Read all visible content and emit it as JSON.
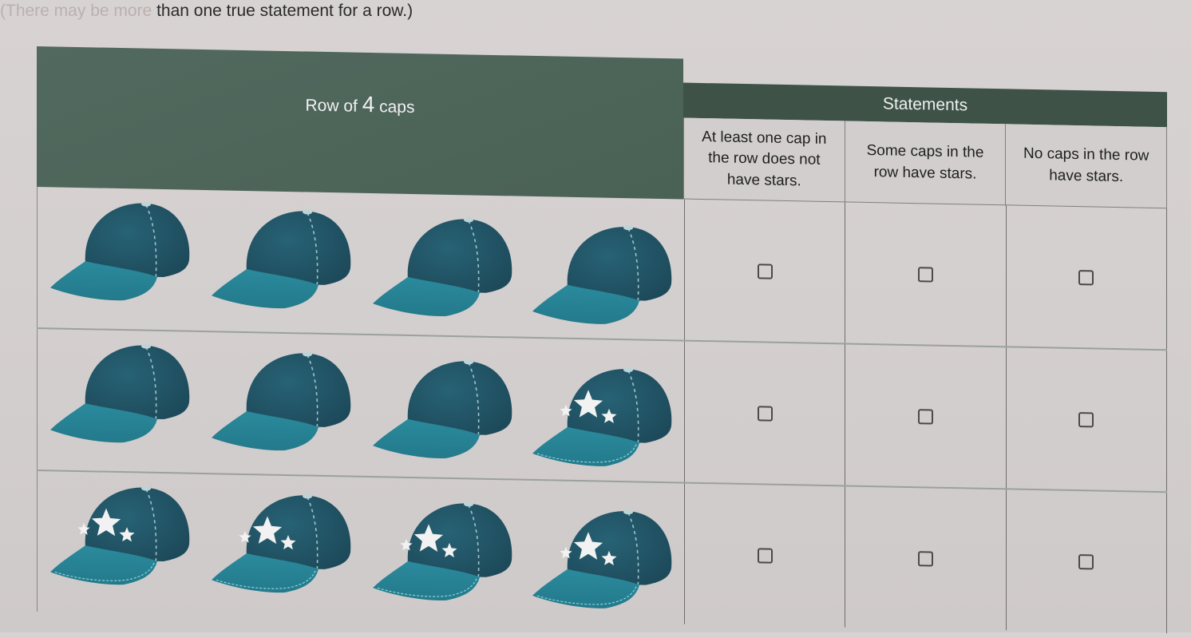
{
  "instruction": {
    "faded_part": "(There may be more ",
    "main_part": "than one true statement for a row.)"
  },
  "table": {
    "left_header": {
      "prefix": "Row of ",
      "number": "4",
      "suffix": " caps"
    },
    "statements_header": "Statements",
    "statements": [
      "At least one cap in the row does not have stars.",
      "Some caps in the row have stars.",
      "No caps in the row have stars."
    ],
    "rows": [
      {
        "caps": [
          {
            "stars": false,
            "icon": "cap-plain-icon"
          },
          {
            "stars": false,
            "icon": "cap-plain-icon"
          },
          {
            "stars": false,
            "icon": "cap-plain-icon"
          },
          {
            "stars": false,
            "icon": "cap-plain-icon"
          }
        ],
        "checked": [
          false,
          false,
          false
        ]
      },
      {
        "caps": [
          {
            "stars": false,
            "icon": "cap-plain-icon"
          },
          {
            "stars": false,
            "icon": "cap-plain-icon"
          },
          {
            "stars": false,
            "icon": "cap-plain-icon"
          },
          {
            "stars": true,
            "icon": "cap-stars-icon"
          }
        ],
        "checked": [
          false,
          false,
          false
        ]
      },
      {
        "caps": [
          {
            "stars": true,
            "icon": "cap-stars-icon"
          },
          {
            "stars": true,
            "icon": "cap-stars-icon"
          },
          {
            "stars": true,
            "icon": "cap-stars-icon"
          },
          {
            "stars": true,
            "icon": "cap-stars-icon"
          }
        ],
        "checked": [
          false,
          false,
          false
        ]
      }
    ]
  },
  "colors": {
    "header_green": "#4d6459",
    "statements_bar": "#3e5248",
    "cap_crown": "#1d4a5a",
    "cap_brim": "#2a8a9c",
    "star": "#f2f2f2"
  }
}
